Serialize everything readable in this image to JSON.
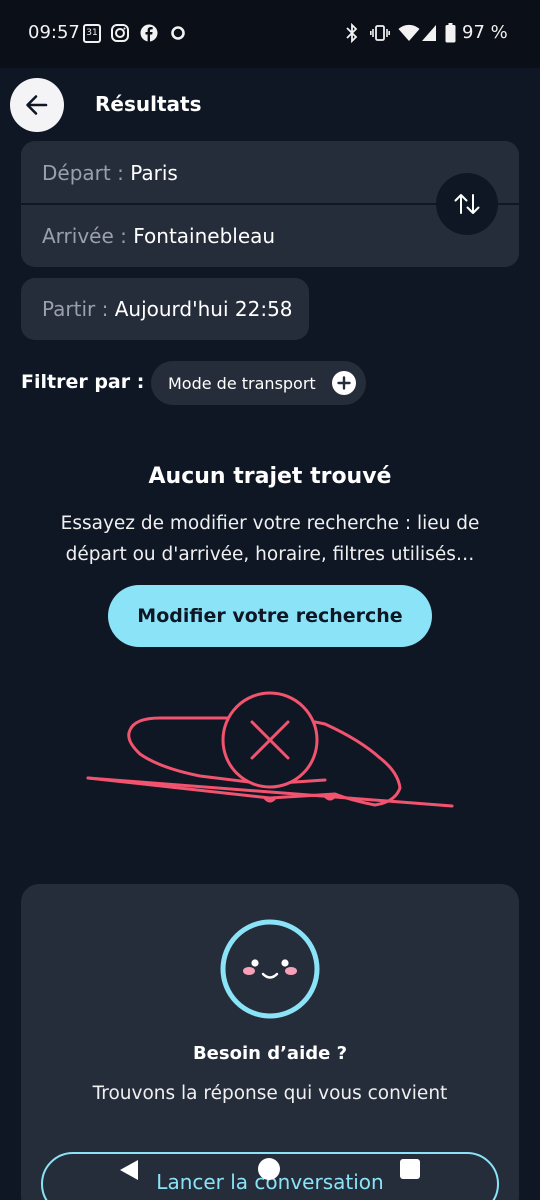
{
  "status_bar": {
    "time": "09:57",
    "battery": "97 %",
    "left_icons": [
      "calendar-icon",
      "instagram-icon",
      "facebook-icon",
      "circle-icon"
    ],
    "right_icons": [
      "bluetooth-icon",
      "vibrate-icon",
      "wifi-icon",
      "signal-icon",
      "battery-icon"
    ],
    "calendar_day": "31"
  },
  "header": {
    "title": "Résultats"
  },
  "route": {
    "departure_label": "Départ :",
    "departure_value": "Paris",
    "arrival_label": "Arrivée :",
    "arrival_value": "Fontainebleau"
  },
  "when": {
    "label": "Partir :",
    "value": "Aujourd'hui 22:58"
  },
  "filter": {
    "label": "Filtrer par :",
    "chip_label": "Mode de transport"
  },
  "empty_state": {
    "title": "Aucun trajet trouvé",
    "description": "Essayez de modifier votre recherche : lieu de départ ou d'arrivée, horaire, filtres utilisés…",
    "button_label": "Modifier votre recherche"
  },
  "help": {
    "title": "Besoin d’aide ?",
    "subtitle": "Trouvons la réponse qui vous convient",
    "button_label": "Lancer la conversation"
  },
  "colors": {
    "background": "#0f1725",
    "card": "#262d3a",
    "accent": "#8ae3f7",
    "error": "#f2536e",
    "blush": "#f7a1b8"
  }
}
